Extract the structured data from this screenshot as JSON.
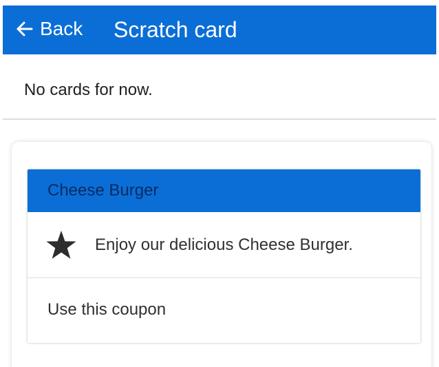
{
  "header": {
    "back_label": "Back",
    "title": "Scratch card"
  },
  "status": {
    "message": "No cards for now."
  },
  "coupon": {
    "name": "Cheese Burger",
    "description": "Enjoy our delicious Cheese Burger.",
    "action_label": "Use this coupon",
    "icon": "star-icon"
  },
  "theme": {
    "accent": "#0b6ed6",
    "header_text": "#ffffff",
    "coupon_header_text": "#082c63",
    "text": "#303030"
  }
}
